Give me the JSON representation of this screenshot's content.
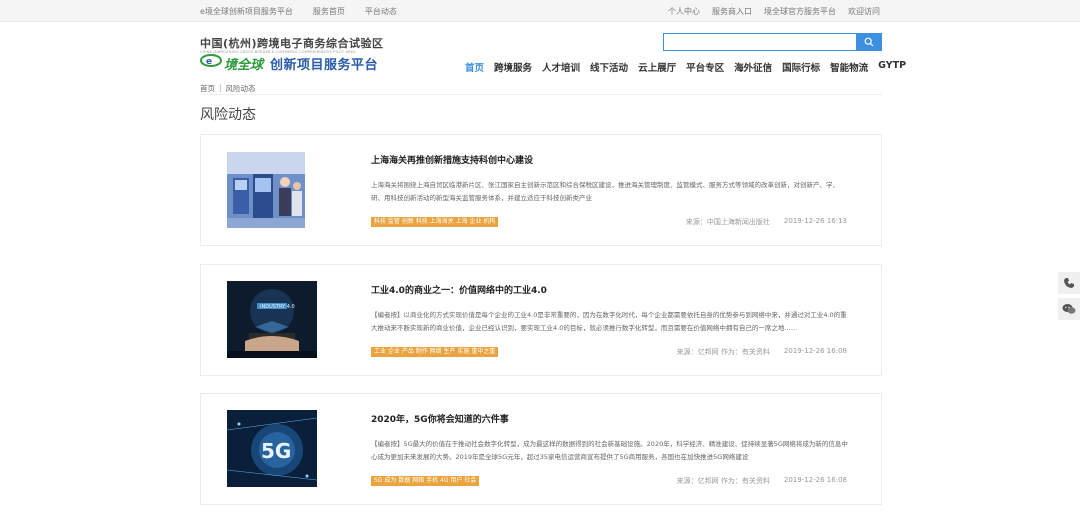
{
  "topbar": {
    "left": [
      "e境全球创新项目服务平台",
      "服务首页",
      "平台动态"
    ],
    "right": [
      "个人中心",
      "服务商入口",
      "境全球官方服务平台",
      "欢迎访问"
    ]
  },
  "header": {
    "logo_cn": "中国(杭州)跨境电子商务综合试验区",
    "logo_en": "CHINA (HANGZHOU) CROSS BORDER E-COMMERCE COMPREHENSIVE PILOT AREA",
    "logo_brand": "境全球",
    "logo_title": "创新项目服务平台",
    "search_placeholder": ""
  },
  "nav": {
    "items": [
      "首页",
      "跨境服务",
      "人才培训",
      "线下活动",
      "云上展厅",
      "平台专区",
      "海外征信",
      "国际行标",
      "智能物流",
      "GYTP"
    ]
  },
  "breadcrumb": [
    "首页",
    "风险动态"
  ],
  "page_title": "风险动态",
  "articles": [
    {
      "title": "上海海关再推创新措施支持科创中心建设",
      "summary": "上海海关将围绕上海自贸区临港新片区、张江国家自主创新示范区和综合保税区建设，推进海关管理制度、监管模式、服务方式等领域的改革创新，对创新产、学、研、用科技创新活动的新型海关监管服务体系，并建立适应于科技创新类产业",
      "tags": "科技 监管 创新 科技 上海海关 上海 企业 机构",
      "source": "来源：中国上海新闻出版社",
      "date": "2019-12-26 16:13"
    },
    {
      "title": "工业4.0的商业之一：价值网络中的工业4.0",
      "summary": "【编者按】以商业化的方式实现价值是每个企业的工业4.0是非常重要的，因为在数字化时代，每个企业都需要依托自身的优势参与到网络中来，并通过对工业4.0的重大推动来不断实现新的商业价值，企业已经认识到，要实现工业4.0的目标，就必须推行数字化转型，而且需要在价值网络中拥有自己的一席之地……",
      "tags": "工业 企业 产品 制作 网络 生产 实施 重中之重",
      "source": "来源：亿邦网 作为：有关资料",
      "date": "2019-12-26 16:08"
    },
    {
      "title": "2020年，5G你将会知道的六件事",
      "summary": "【编者按】5G最大的价值在于推动社会数字化转型，成为最这样的数据得到的社会新基础设施。2020年，科学经济、精准建设、促持续显著5G网络将成为新的信息中心成为更加未来发展的大势。2019年是全球5G元年，超过35家电信运营商宣布提供了5G商用服务，各国也在加快推进5G网络建设",
      "tags": "5G 成为 数据 网络 手机 4G 用户 社会",
      "source": "来源：亿邦网 作为：有关资料",
      "date": "2019-12-26 16:08"
    }
  ],
  "colors": {
    "accent": "#3d8fe0",
    "tag": "#e9a33f",
    "brand_green": "#2e9b3e",
    "brand_blue": "#2a5ca8"
  },
  "icons": [
    "search-icon",
    "phone-icon",
    "wechat-icon"
  ]
}
